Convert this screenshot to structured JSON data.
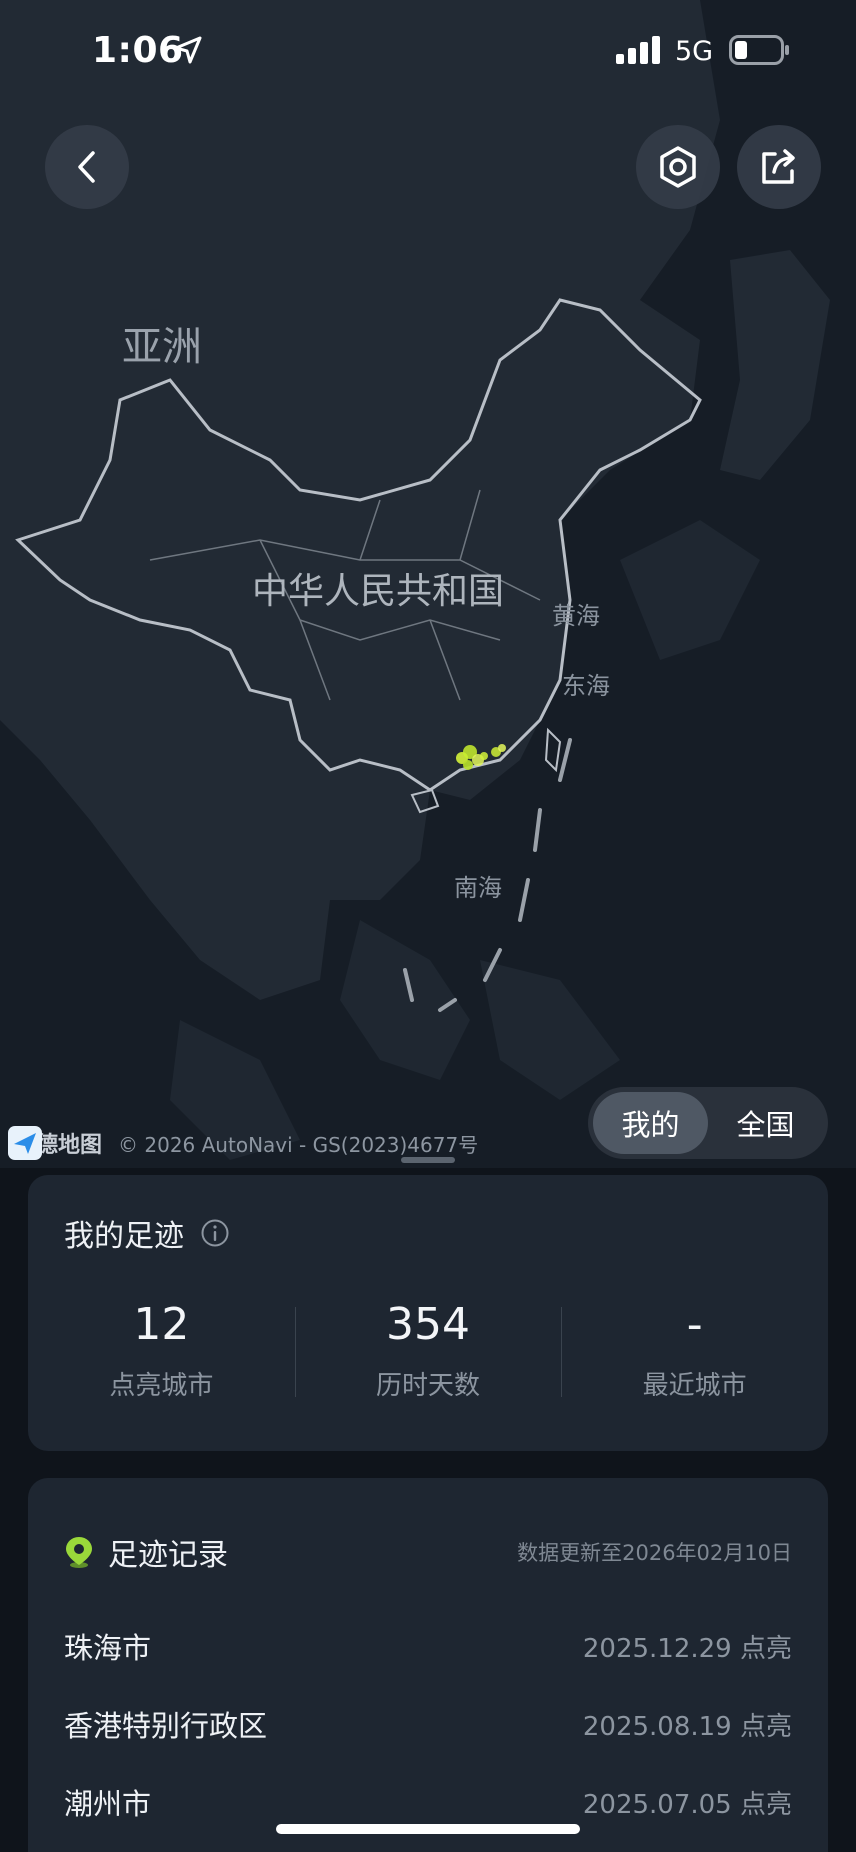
{
  "status_bar": {
    "time": "1:06",
    "network": "5G",
    "icons": [
      "location-arrow-icon",
      "signal-icon",
      "battery-icon"
    ]
  },
  "nav": {
    "back_icon": "chevron-left-icon",
    "settings_icon": "hexagon-settings-icon",
    "share_icon": "share-icon"
  },
  "map": {
    "labels": {
      "continent": "亚洲",
      "country": "中华人民共和国",
      "yellow_sea": "黄海",
      "east_sea": "东海",
      "south_sea": "南海"
    },
    "logo_text": "高德地图",
    "copyright": "© 2026 AutoNavi - GS(2023)4677号",
    "highlight_color": "#d4f23a"
  },
  "toggle": {
    "options": [
      "我的",
      "全国"
    ],
    "selected": "我的"
  },
  "footprint_card": {
    "title": "我的足迹",
    "stats": [
      {
        "value": "12",
        "label": "点亮城市"
      },
      {
        "value": "354",
        "label": "历时天数"
      },
      {
        "value": "-",
        "label": "最近城市"
      }
    ]
  },
  "records_card": {
    "title": "足迹记录",
    "updated": "数据更新至2026年02月10日",
    "records": [
      {
        "city": "珠海市",
        "date": "2025.12.29 点亮"
      },
      {
        "city": "香港特别行政区",
        "date": "2025.08.19 点亮"
      },
      {
        "city": "潮州市",
        "date": "2025.07.05 点亮"
      }
    ]
  },
  "colors": {
    "background": "#0f141b",
    "card": "#1e2631",
    "map_land": "#222a34",
    "accent_green": "#9ad83a"
  }
}
